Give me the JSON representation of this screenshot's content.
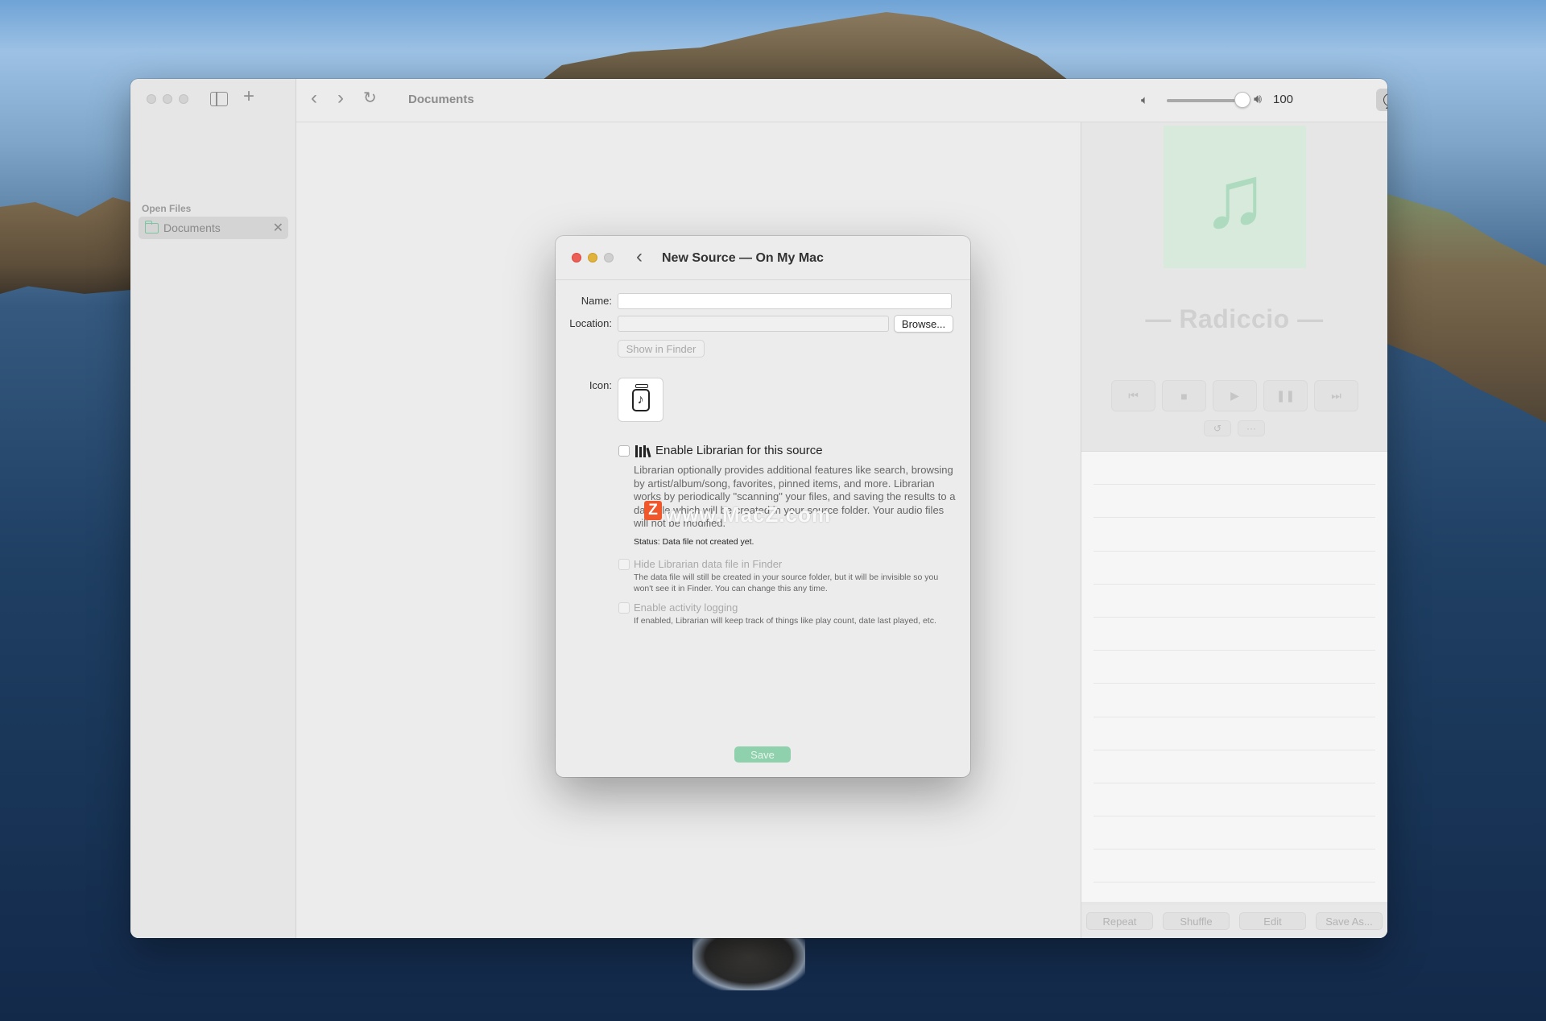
{
  "window": {
    "sidebar": {
      "section_label": "Open Files",
      "items": [
        {
          "label": "Documents",
          "icon": "folder-icon"
        }
      ]
    },
    "toolbar": {
      "title": "Documents",
      "volume": 100,
      "volume_label": "100"
    },
    "player": {
      "track_title": "— Radiccio —",
      "artwork_icon": "music-note-icon",
      "transport": [
        "previous-icon",
        "stop-icon",
        "play-icon",
        "pause-icon",
        "next-icon"
      ],
      "small_buttons": [
        "replay-icon",
        "more-icon"
      ],
      "bottom_buttons": [
        "Repeat",
        "Shuffle",
        "Edit",
        "Save As..."
      ],
      "list_rows": 13
    }
  },
  "sheet": {
    "title": "New Source — On My Mac",
    "name_label": "Name:",
    "name_value": "",
    "location_label": "Location:",
    "location_value": "",
    "browse_label": "Browse...",
    "show_in_finder_label": "Show in Finder",
    "icon_label": "Icon:",
    "enable_librarian": {
      "label": "Enable Librarian for this source",
      "checked": false,
      "description": "Librarian optionally provides additional features like search, browsing by artist/album/song, favorites, pinned items, and more. Librarian works by periodically \"scanning\" your files, and saving the results to a data file which will be created in your source folder. Your audio files will not be modified.",
      "status": "Status: Data file not created yet."
    },
    "hide_data_file": {
      "label": "Hide Librarian data file in Finder",
      "checked": false,
      "description": "The data file will still be created in your source folder, but it will be invisible so you won't see it in Finder. You can change this any time."
    },
    "activity_logging": {
      "label": "Enable activity logging",
      "checked": false,
      "description": "If enabled, Librarian will keep track of things like play count, date last played, etc."
    },
    "watermark": "www.MacZ.com",
    "watermark_logo": "Z",
    "save_label": "Save"
  },
  "colors": {
    "accent": "#8fd0ad",
    "close": "#ec5f57",
    "minimize": "#e0b33c",
    "zoom_disabled": "#cfcfcf"
  }
}
